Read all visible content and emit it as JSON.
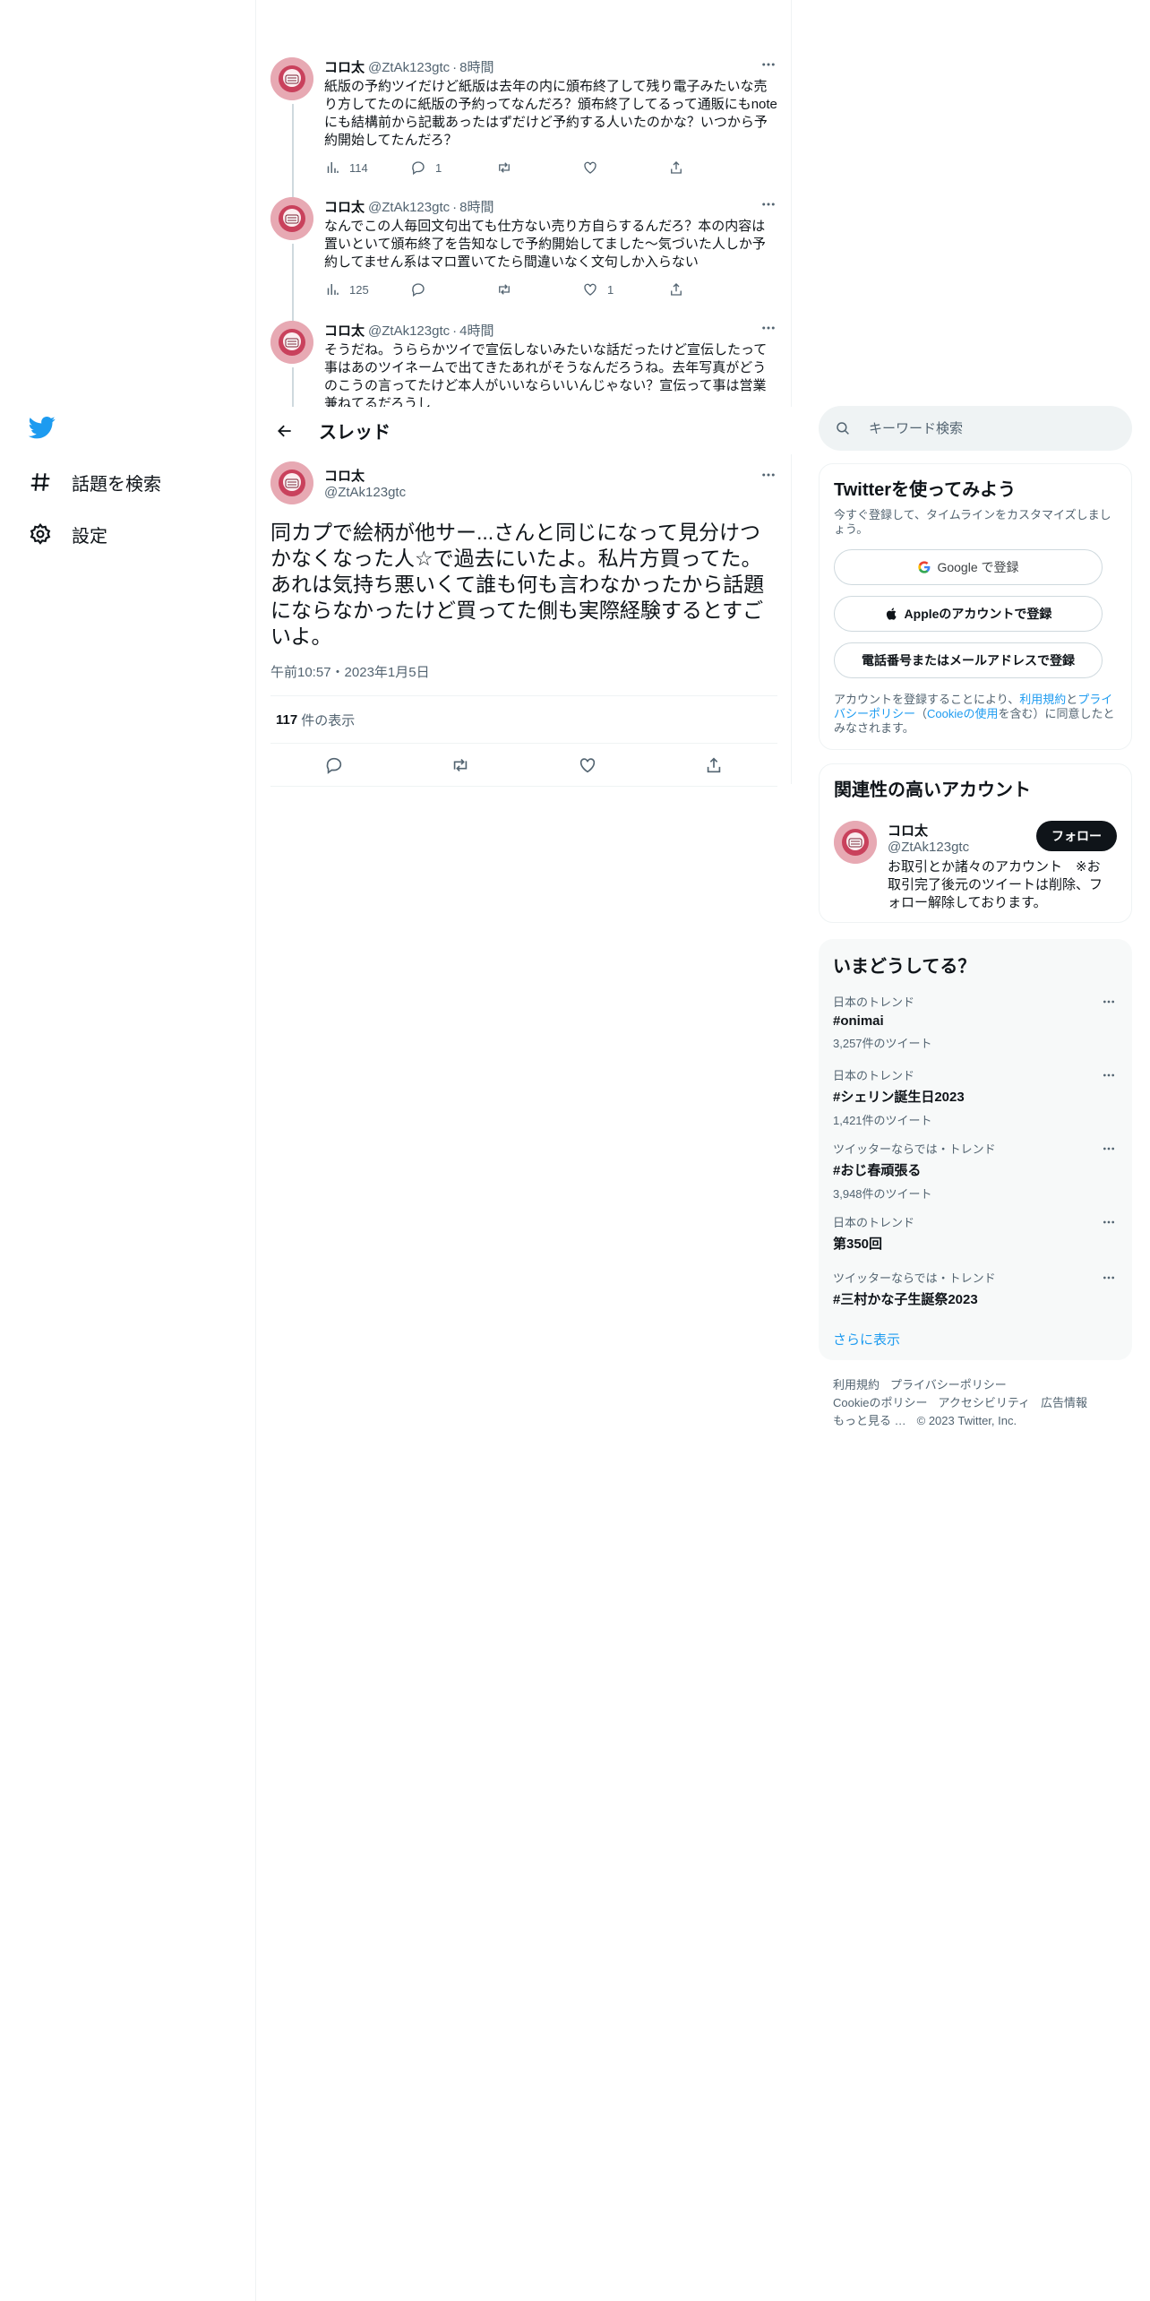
{
  "nav": {
    "items": [
      {
        "label": "話題を検索",
        "icon": "hashtag-icon"
      },
      {
        "label": "設定",
        "icon": "gear-icon"
      }
    ]
  },
  "prev_tweets": [
    {
      "name": "コロ太",
      "handle": "@ZtAk123gtc",
      "time": "8時間",
      "text": "紙版の予約ツイだけど紙版は去年の内に頒布終了して残り電子みたいな売り方してたのに紙版の予約ってなんだろ？頒布終了してるって通販にもnoteにも結構前から記載あったはずだけど予約する人いたのかな？いつから予約開始してたんだろ？",
      "views": "114",
      "replies": "1",
      "retweets": "",
      "likes": ""
    },
    {
      "name": "コロ太",
      "handle": "@ZtAk123gtc",
      "time": "8時間",
      "text": "なんでこの人毎回文句出ても仕方ない売り方自らするんだろ？本の内容は置いといて頒布終了を告知なしで予約開始してました〜気づいた人しか予約してません系はマロ置いてたら間違いなく文句しか入らない",
      "views": "125",
      "replies": "",
      "retweets": "",
      "likes": "1"
    },
    {
      "name": "コロ太",
      "handle": "@ZtAk123gtc",
      "time": "4時間",
      "text": "そうだね。うららかツイで宣伝しないみたいな話だったけど宣伝したって事はあのツイネームで出てきたあれがそうなんだろうね。去年写真がどうのこうの言ってたけど本人がいいならいいんじゃない？宣伝って事は営業兼ねてるだろうし"
    }
  ],
  "thread": {
    "title": "スレッド"
  },
  "main_tweet": {
    "name": "コロ太",
    "handle": "@ZtAk123gtc",
    "text": "同カプで絵柄が他サー...さんと同じになって見分けつかなくなった人☆で過去にいたよ。私片方買ってた。あれは気持ち悪いくて誰も何も言わなかったから話題にならなかったけど買ってた側も実際経験するとすごいよ。",
    "timestamp": "午前10:57・2023年1月5日",
    "views_count": "117",
    "views_label": "件の表示"
  },
  "search": {
    "placeholder": "キーワード検索"
  },
  "signup": {
    "title": "Twitterを使ってみよう",
    "subtitle": "今すぐ登録して、タイムラインをカスタマイズしましょう。",
    "google_btn": "Google で登録",
    "apple_btn": "Appleのアカウントで登録",
    "phone_btn": "電話番号またはメールアドレスで登録",
    "legal_pre": "アカウントを登録することにより、",
    "legal_link1": "利用規約",
    "legal_and": "と",
    "legal_link2": "プライバシーポリシー",
    "legal_paren_open": "（",
    "legal_link3": "Cookieの使用",
    "legal_post": "を含む）に同意したとみなされます。"
  },
  "related": {
    "title": "関連性の高いアカウント",
    "name": "コロ太",
    "handle": "@ZtAk123gtc",
    "bio": "お取引とか諸々のアカウント　※お取引完了後元のツイートは削除、フォロー解除しております。",
    "follow_label": "フォロー"
  },
  "trends": {
    "title": "いまどうしてる？",
    "items": [
      {
        "context": "日本のトレンド",
        "name": "#onimai",
        "count": "3,257件のツイート"
      },
      {
        "context": "日本のトレンド",
        "name": "#シェリン誕生日2023",
        "count": "1,421件のツイート"
      },
      {
        "context": "ツイッターならでは・トレンド",
        "name": "#おじ春頑張る",
        "count": "3,948件のツイート"
      },
      {
        "context": "日本のトレンド",
        "name": "第350回",
        "count": ""
      },
      {
        "context": "ツイッターならでは・トレンド",
        "name": "#三村かな子生誕祭2023",
        "count": ""
      }
    ],
    "show_more": "さらに表示"
  },
  "footer": {
    "links": [
      "利用規約",
      "プライバシーポリシー",
      "Cookieのポリシー",
      "アクセシビリティ",
      "広告情報",
      "もっと見る …"
    ],
    "copyright": "© 2023 Twitter, Inc."
  },
  "colors": {
    "accent": "#1d9bf0",
    "text": "#0f1419",
    "muted": "#536471"
  }
}
